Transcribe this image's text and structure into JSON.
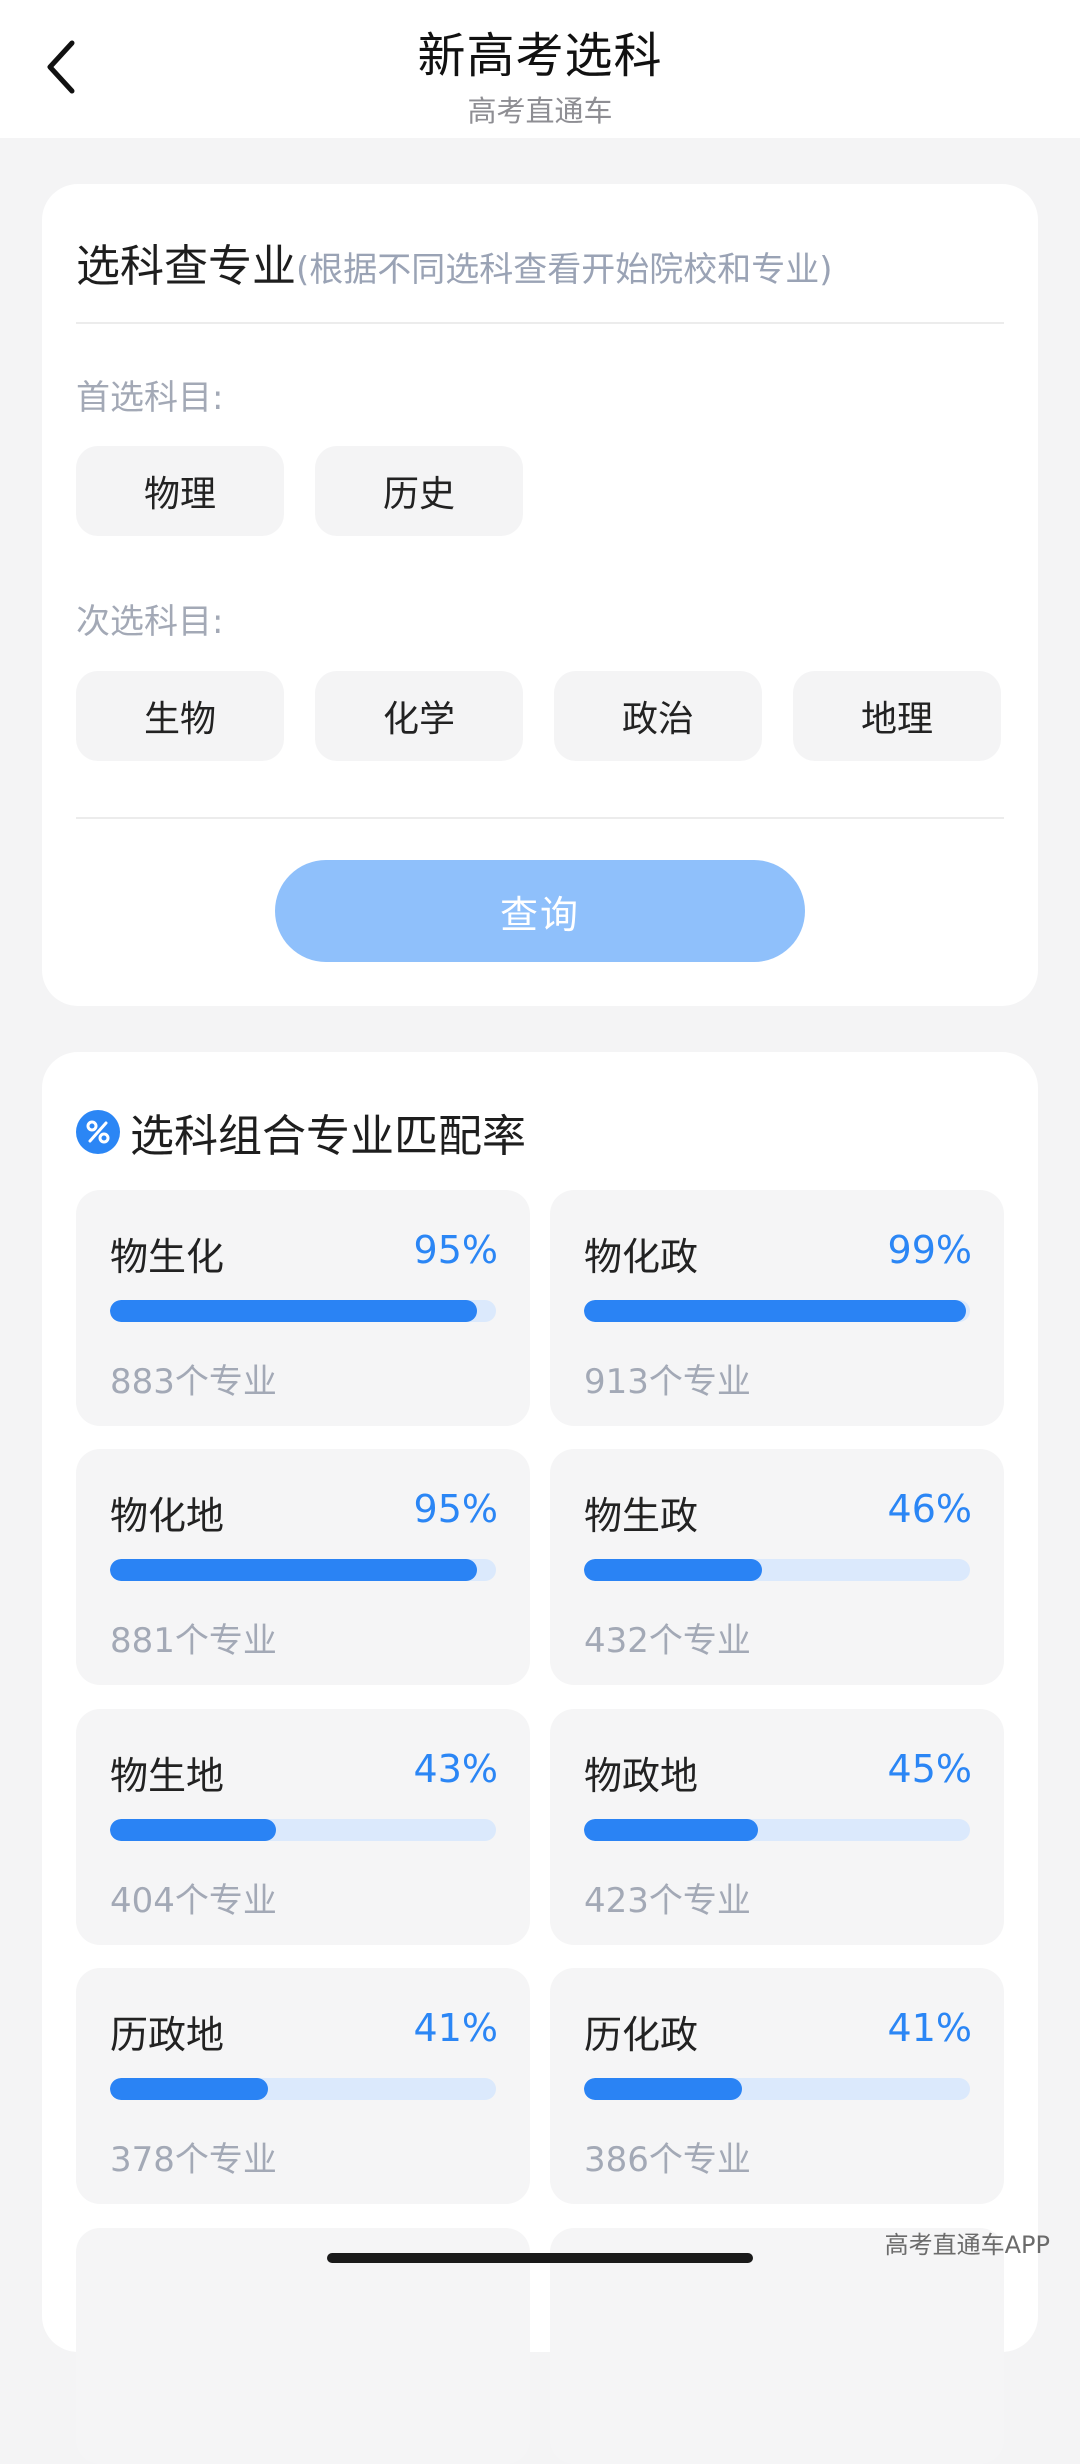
{
  "header": {
    "title": "新高考选科",
    "subtitle": "高考直通车"
  },
  "selector": {
    "title": "选科查专业",
    "note": "(根据不同选科查看开始院校和专业)",
    "primary_label": "首选科目:",
    "primary_options": [
      "物理",
      "历史"
    ],
    "secondary_label": "次选科目:",
    "secondary_options": [
      "生物",
      "化学",
      "政治",
      "地理"
    ],
    "query_label": "查询"
  },
  "match": {
    "title": "选科组合专业匹配率",
    "icon": "percent-icon",
    "items": [
      {
        "combo": "物生化",
        "pct_label": "95%",
        "value": 95,
        "count": "883个专业"
      },
      {
        "combo": "物化政",
        "pct_label": "99%",
        "value": 99,
        "count": "913个专业"
      },
      {
        "combo": "物化地",
        "pct_label": "95%",
        "value": 95,
        "count": "881个专业"
      },
      {
        "combo": "物生政",
        "pct_label": "46%",
        "value": 46,
        "count": "432个专业"
      },
      {
        "combo": "物生地",
        "pct_label": "43%",
        "value": 43,
        "count": "404个专业"
      },
      {
        "combo": "物政地",
        "pct_label": "45%",
        "value": 45,
        "count": "423个专业"
      },
      {
        "combo": "历政地",
        "pct_label": "41%",
        "value": 41,
        "count": "378个专业"
      },
      {
        "combo": "历化政",
        "pct_label": "41%",
        "value": 41,
        "count": "386个专业"
      }
    ]
  },
  "watermark": "高考直通车APP",
  "colors": {
    "accent": "#2b86f5",
    "query_button": "#8fc0fb",
    "track": "#dbe9fc",
    "background": "#f4f4f5"
  }
}
